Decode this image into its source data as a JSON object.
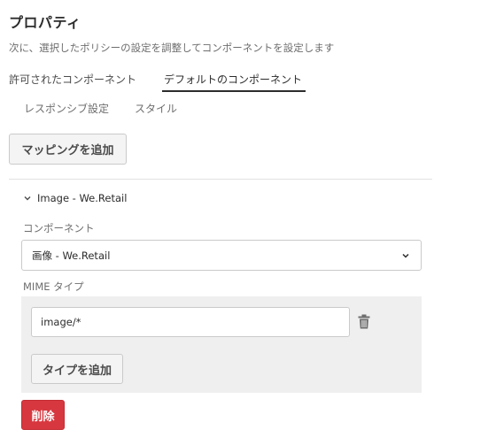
{
  "header": {
    "title": "プロパティ",
    "subtitle": "次に、選択したポリシーの設定を調整してコンポーネントを設定します"
  },
  "tabs": {
    "primary": [
      {
        "label": "許可されたコンポーネント",
        "selected": false
      },
      {
        "label": "デフォルトのコンポーネント",
        "selected": true
      }
    ],
    "secondary": [
      {
        "label": "レスポンシブ設定"
      },
      {
        "label": "スタイル"
      }
    ]
  },
  "mappings": {
    "add_button_label": "マッピングを追加",
    "item": {
      "title": "Image - We.Retail",
      "component_label": "コンポーネント",
      "component_value": "画像 - We.Retail",
      "mime_label": "MIME タイプ",
      "mime_value": "image/*",
      "add_type_label": "タイプを追加",
      "delete_label": "削除"
    }
  },
  "colors": {
    "accent_text": "#2c2c2c",
    "danger": "#d7373f",
    "panel_bg": "#efefef"
  }
}
